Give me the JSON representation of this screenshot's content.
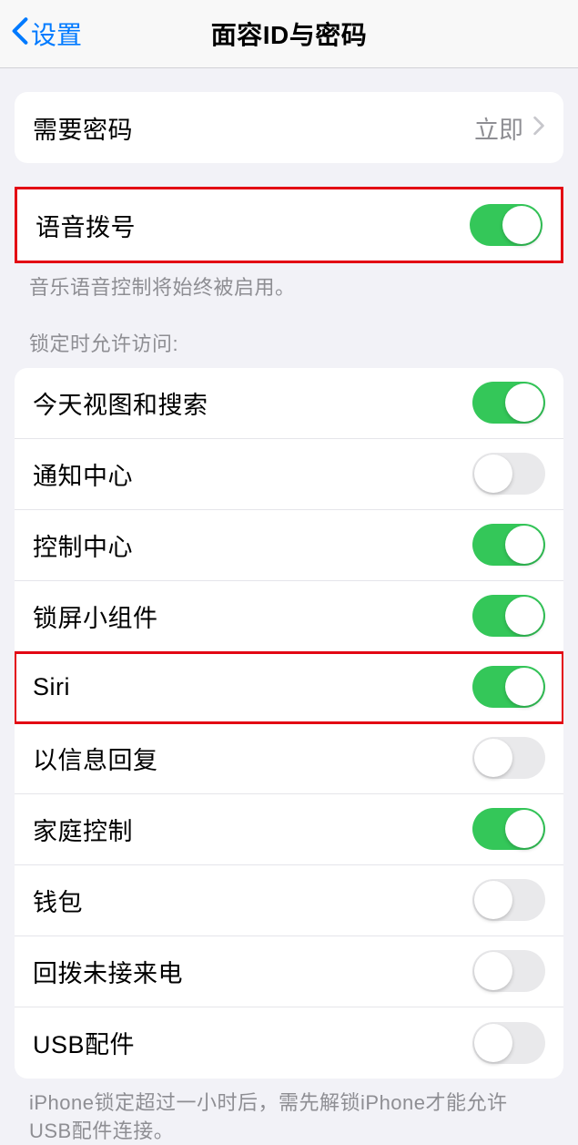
{
  "nav": {
    "back_label": "设置",
    "title": "面容ID与密码"
  },
  "require_passcode": {
    "label": "需要密码",
    "value": "立即"
  },
  "voice_dial": {
    "label": "语音拨号",
    "on": true,
    "footer": "音乐语音控制将始终被启用。"
  },
  "allow_when_locked": {
    "header": "锁定时允许访问:",
    "items": [
      {
        "label": "今天视图和搜索",
        "on": true
      },
      {
        "label": "通知中心",
        "on": false
      },
      {
        "label": "控制中心",
        "on": true
      },
      {
        "label": "锁屏小组件",
        "on": true
      },
      {
        "label": "Siri",
        "on": true,
        "highlighted": true
      },
      {
        "label": "以信息回复",
        "on": false
      },
      {
        "label": "家庭控制",
        "on": true
      },
      {
        "label": "钱包",
        "on": false
      },
      {
        "label": "回拨未接来电",
        "on": false
      },
      {
        "label": "USB配件",
        "on": false
      }
    ],
    "footer": "iPhone锁定超过一小时后，需先解锁iPhone才能允许USB配件连接。"
  }
}
